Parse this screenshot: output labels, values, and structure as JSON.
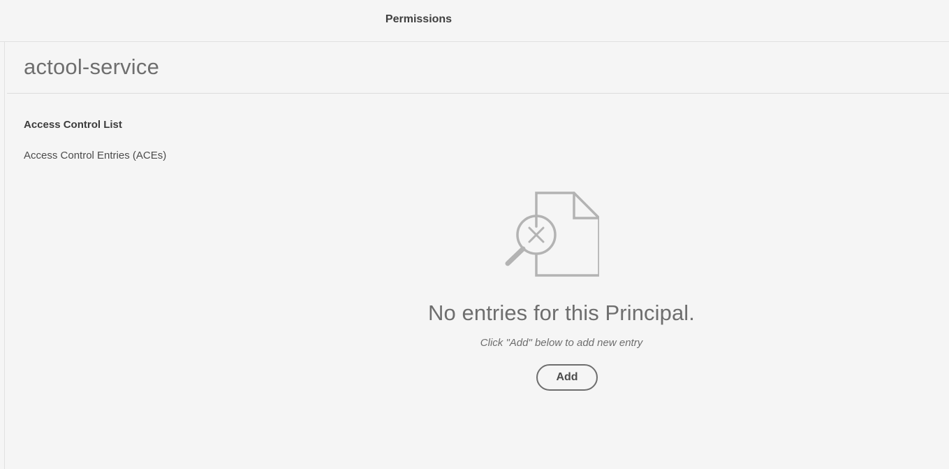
{
  "topbar": {
    "title": "Permissions"
  },
  "principal": {
    "name": "actool-service"
  },
  "acl": {
    "heading": "Access Control List",
    "subheading": "Access Control Entries (ACEs)"
  },
  "empty_state": {
    "icon": "document-search-x-icon",
    "message": "No entries for this Principal.",
    "hint": "Click \"Add\" below to add new entry",
    "add_label": "Add"
  },
  "colors": {
    "background": "#f5f5f5",
    "icon_stroke": "#b3b3b3",
    "text_primary": "#4b4b4b",
    "text_secondary": "#6e6e6e"
  }
}
